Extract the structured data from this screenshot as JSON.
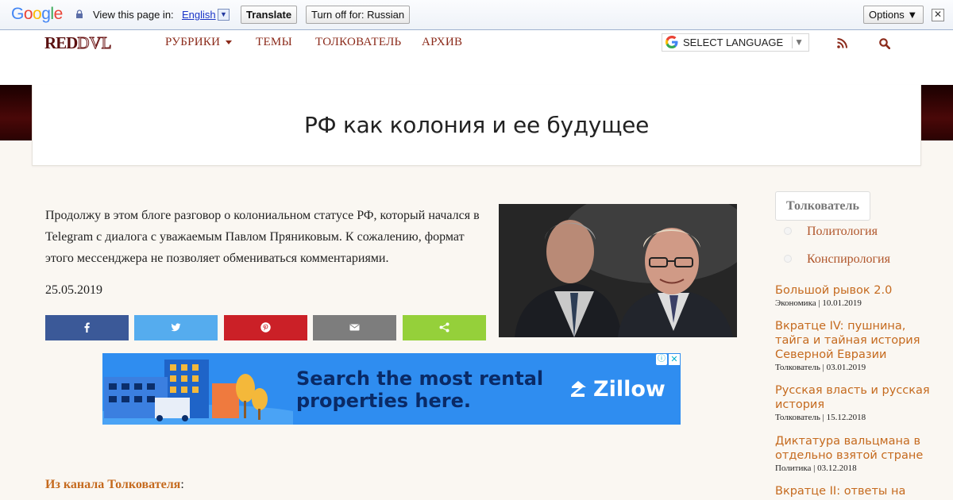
{
  "translate_bar": {
    "logo": "Google",
    "view_text": "View this page in:",
    "language": "English",
    "translate_button": "Translate",
    "turn_off_button": "Turn off for: Russian",
    "options_button": "Options ▼",
    "close": "✕"
  },
  "header": {
    "logo_red": "RED",
    "logo_dvl": "DVL",
    "nav": [
      "РУБРИКИ",
      "ТЕМЫ",
      "ТОЛКОВАТЕЛЬ",
      "АРХИВ"
    ],
    "select_language": "SELECT LANGUAGE",
    "icons": [
      "rss-icon",
      "search-icon"
    ]
  },
  "page": {
    "title": "РФ как колония и ее будущее",
    "intro": "Продолжу в этом блоге разговор о колониальном статусе РФ, который начался в Telegram с диалога с уважаемым Павлом Пряниковым. К сожалению, формат этого мессенджера не позволяет обмениваться комментариями.",
    "date": "25.05.2019",
    "channel_link": "Из канала Толкователя",
    "channel_suffix": ":"
  },
  "share": [
    {
      "icon": "facebook-icon",
      "color": "#3b5998"
    },
    {
      "icon": "twitter-icon",
      "color": "#55acee"
    },
    {
      "icon": "pinterest-icon",
      "color": "#cb2027"
    },
    {
      "icon": "email-icon",
      "color": "#7d7d7d"
    },
    {
      "icon": "sharethis-icon",
      "color": "#95d03a"
    }
  ],
  "ad": {
    "headline_1": "Search the most rental",
    "headline_2": "properties here.",
    "brand": "Zillow",
    "info": "ⓘ",
    "close": "✕"
  },
  "sidebar": {
    "tag": "Толкователь",
    "sub_categories": [
      "Политология",
      "Конспирология"
    ],
    "posts": [
      {
        "title": "Большой рывок 2.0",
        "meta": "Экономика | 10.01.2019"
      },
      {
        "title": "Вкратце IV: пушнина, тайга и тайная история Северной Евразии",
        "meta": "Толкователь | 03.01.2019"
      },
      {
        "title": "Русская власть и русская история",
        "meta": "Толкователь | 15.12.2018"
      },
      {
        "title": "Диктатура вальцмана в отдельно взятой стране",
        "meta": "Политика | 03.12.2018"
      },
      {
        "title": "Вкратце II: ответы на",
        "meta": ""
      }
    ]
  },
  "colors": {
    "accent": "#c56a1e",
    "nav": "#8b2a1a",
    "band": "#3a0505",
    "ad_bg": "#2f8df0"
  }
}
